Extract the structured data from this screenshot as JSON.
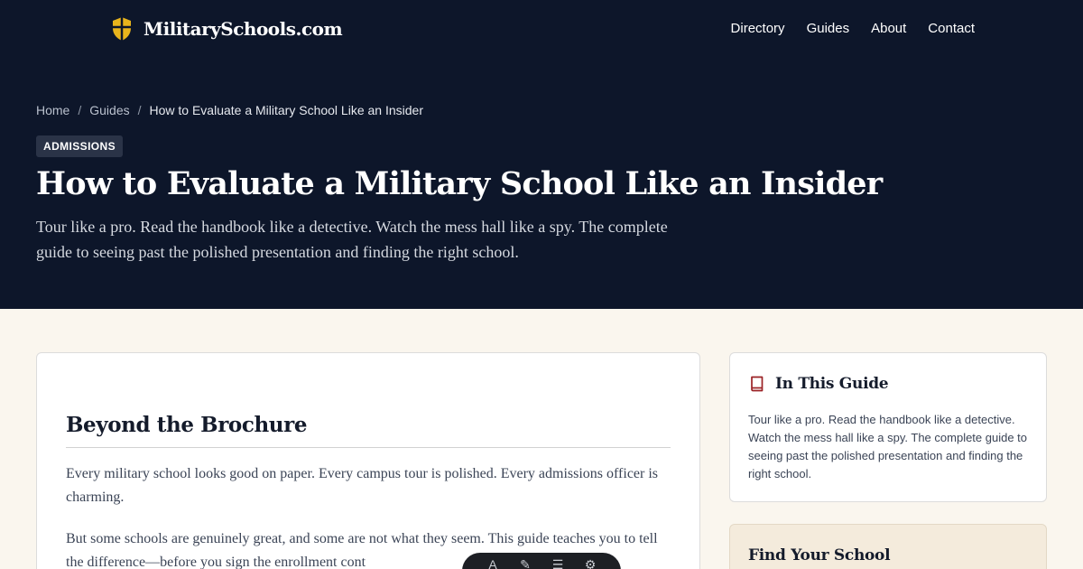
{
  "header": {
    "brand": "MilitarySchools.com",
    "nav": [
      "Directory",
      "Guides",
      "About",
      "Contact"
    ]
  },
  "breadcrumb": {
    "home": "Home",
    "section": "Guides",
    "current": "How to Evaluate a Military School Like an Insider"
  },
  "hero": {
    "badge": "ADMISSIONS",
    "title": "How to Evaluate a Military School Like an Insider",
    "subtitle": "Tour like a pro. Read the handbook like a detective. Watch the mess hall like a spy. The complete guide to seeing past the polished presentation and finding the right school."
  },
  "article": {
    "heading": "Beyond the Brochure",
    "paragraph1": "Every military school looks good on paper. Every campus tour is polished. Every admissions officer is charming.",
    "paragraph2": "But some schools are genuinely great, and some are not what they seem. This guide teaches you to tell the difference—before you sign the enrollment cont"
  },
  "sidebar": {
    "toc_title": "In This Guide",
    "toc_text": "Tour like a pro. Read the handbook like a detective. Watch the mess hall like a spy. The complete guide to seeing past the polished presentation and finding the right school.",
    "find_title": "Find Your School"
  },
  "icons": {
    "logo": "shield-icon",
    "toc": "book-icon"
  },
  "colors": {
    "hero_bg": "#0d162a",
    "accent_gold": "#e8b41c",
    "accent_red": "#9b2226",
    "page_bg": "#faf6ee"
  }
}
